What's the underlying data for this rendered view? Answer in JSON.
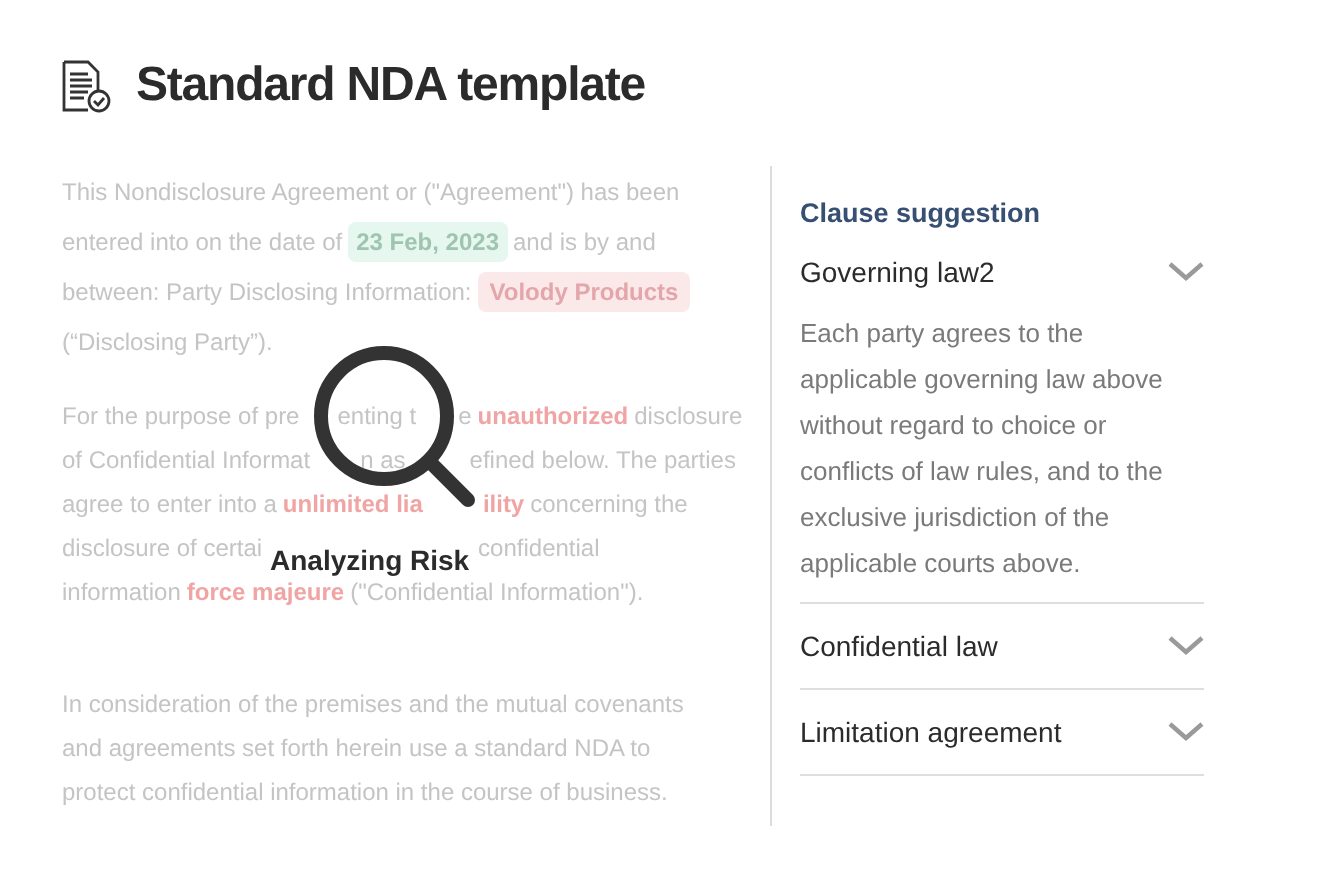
{
  "title": "Standard NDA template",
  "document": [
    {
      "lines": [
        [
          {
            "kind": "plain",
            "text": "This Nondisclosure Agreement or (\"Agreement\") has been"
          }
        ],
        [
          {
            "kind": "plain",
            "text": "entered into on the date of"
          },
          {
            "kind": "date",
            "text": "23 Feb, 2023"
          },
          {
            "kind": "plain",
            "text": "and is by and"
          }
        ],
        [
          {
            "kind": "plain",
            "text": "between: Party Disclosing Information:"
          },
          {
            "kind": "party",
            "text": "Volody Products"
          }
        ],
        [
          {
            "kind": "plain",
            "text": "(“Disclosing Party”)."
          }
        ]
      ]
    },
    {
      "lines": [
        [
          {
            "kind": "plain",
            "text": "For the purpose of pre"
          },
          {
            "kind": "gap"
          },
          {
            "kind": "plain",
            "text": "enting t"
          },
          {
            "kind": "gap"
          },
          {
            "kind": "plain",
            "text": "e"
          },
          {
            "kind": "risk",
            "text": "unauthorized"
          },
          {
            "kind": "plain",
            "text": "disclosure"
          }
        ],
        [
          {
            "kind": "plain",
            "text": "of Confidential Informat"
          },
          {
            "kind": "gap"
          },
          {
            "kind": "plain",
            "text": "n as"
          },
          {
            "kind": "gap"
          },
          {
            "kind": "plain",
            "text": "efined below. The parties"
          }
        ],
        [
          {
            "kind": "plain",
            "text": "agree to enter into a"
          },
          {
            "kind": "risk",
            "text": "unlimited lia"
          },
          {
            "kind": "gap"
          },
          {
            "kind": "risk",
            "text": "ility"
          },
          {
            "kind": "plain",
            "text": "concerning the"
          }
        ],
        [
          {
            "kind": "plain",
            "text": "disclosure of certai"
          },
          {
            "kind": "label_gap"
          },
          {
            "kind": "plain",
            "text": "confidential"
          }
        ],
        [
          {
            "kind": "plain",
            "text": "information"
          },
          {
            "kind": "risk",
            "text": "force majeure"
          },
          {
            "kind": "plain",
            "text": "(\"Confidential Information\")."
          }
        ]
      ]
    },
    {
      "lines": [
        [
          {
            "kind": "plain",
            "text": "In consideration of the premises and the mutual covenants"
          }
        ],
        [
          {
            "kind": "plain",
            "text": "and agreements set forth herein use a standard NDA to"
          }
        ],
        [
          {
            "kind": "plain",
            "text": "protect confidential information in the course of business."
          }
        ]
      ]
    }
  ],
  "overlay": {
    "label": "Analyzing Risk"
  },
  "panel": {
    "heading": "Clause suggestion",
    "clauses": [
      {
        "title": "Governing law2",
        "expanded": true,
        "body": "Each party agrees to the applicable governing law above without regard to choice or conflicts of law rules, and to the exclusive jurisdiction of the applicable courts above."
      },
      {
        "title": "Confidential law",
        "expanded": false
      },
      {
        "title": "Limitation agreement",
        "expanded": false
      }
    ]
  }
}
